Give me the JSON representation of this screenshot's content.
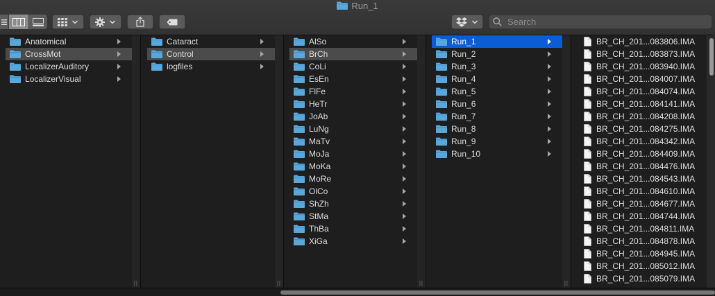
{
  "window": {
    "title": "Run_1"
  },
  "toolbar": {
    "search_placeholder": "Search"
  },
  "columns": [
    {
      "items": [
        {
          "label": "Anatomical",
          "kind": "folder",
          "has_children": true,
          "state": "normal"
        },
        {
          "label": "CrossMot",
          "kind": "folder",
          "has_children": true,
          "state": "selected-inactive"
        },
        {
          "label": "LocalizerAuditory",
          "kind": "folder",
          "has_children": true,
          "state": "normal"
        },
        {
          "label": "LocalizerVisual",
          "kind": "folder",
          "has_children": true,
          "state": "normal"
        }
      ]
    },
    {
      "items": [
        {
          "label": "Cataract",
          "kind": "folder",
          "has_children": true,
          "state": "normal"
        },
        {
          "label": "Control",
          "kind": "folder",
          "has_children": true,
          "state": "selected-inactive"
        },
        {
          "label": "logfiles",
          "kind": "folder",
          "has_children": true,
          "state": "normal"
        }
      ]
    },
    {
      "items": [
        {
          "label": "AlSo",
          "kind": "folder",
          "has_children": true,
          "state": "normal"
        },
        {
          "label": "BrCh",
          "kind": "folder",
          "has_children": true,
          "state": "selected-inactive"
        },
        {
          "label": "CoLi",
          "kind": "folder",
          "has_children": true,
          "state": "normal"
        },
        {
          "label": "EsEn",
          "kind": "folder",
          "has_children": true,
          "state": "normal"
        },
        {
          "label": "FlFe",
          "kind": "folder",
          "has_children": true,
          "state": "normal"
        },
        {
          "label": "HeTr",
          "kind": "folder",
          "has_children": true,
          "state": "normal"
        },
        {
          "label": "JoAb",
          "kind": "folder",
          "has_children": true,
          "state": "normal"
        },
        {
          "label": "LuNg",
          "kind": "folder",
          "has_children": true,
          "state": "normal"
        },
        {
          "label": "MaTv",
          "kind": "folder",
          "has_children": true,
          "state": "normal"
        },
        {
          "label": "MoJa",
          "kind": "folder",
          "has_children": true,
          "state": "normal"
        },
        {
          "label": "MoKa",
          "kind": "folder",
          "has_children": true,
          "state": "normal"
        },
        {
          "label": "MoRe",
          "kind": "folder",
          "has_children": true,
          "state": "normal"
        },
        {
          "label": "OlCo",
          "kind": "folder",
          "has_children": true,
          "state": "normal"
        },
        {
          "label": "ShZh",
          "kind": "folder",
          "has_children": true,
          "state": "normal"
        },
        {
          "label": "StMa",
          "kind": "folder",
          "has_children": true,
          "state": "normal"
        },
        {
          "label": "ThBa",
          "kind": "folder",
          "has_children": true,
          "state": "normal"
        },
        {
          "label": "XiGa",
          "kind": "folder",
          "has_children": true,
          "state": "normal"
        }
      ]
    },
    {
      "items": [
        {
          "label": "Run_1",
          "kind": "folder",
          "has_children": true,
          "state": "selected-active"
        },
        {
          "label": "Run_2",
          "kind": "folder",
          "has_children": true,
          "state": "normal"
        },
        {
          "label": "Run_3",
          "kind": "folder",
          "has_children": true,
          "state": "normal"
        },
        {
          "label": "Run_4",
          "kind": "folder",
          "has_children": true,
          "state": "normal"
        },
        {
          "label": "Run_5",
          "kind": "folder",
          "has_children": true,
          "state": "normal"
        },
        {
          "label": "Run_6",
          "kind": "folder",
          "has_children": true,
          "state": "normal"
        },
        {
          "label": "Run_7",
          "kind": "folder",
          "has_children": true,
          "state": "normal"
        },
        {
          "label": "Run_8",
          "kind": "folder",
          "has_children": true,
          "state": "normal"
        },
        {
          "label": "Run_9",
          "kind": "folder",
          "has_children": true,
          "state": "normal"
        },
        {
          "label": "Run_10",
          "kind": "folder",
          "has_children": true,
          "state": "normal"
        }
      ]
    },
    {
      "items": [
        {
          "label": "BR_CH_201...083806.IMA",
          "kind": "file",
          "has_children": false,
          "state": "normal"
        },
        {
          "label": "BR_CH_201...083873.IMA",
          "kind": "file",
          "has_children": false,
          "state": "normal"
        },
        {
          "label": "BR_CH_201...083940.IMA",
          "kind": "file",
          "has_children": false,
          "state": "normal"
        },
        {
          "label": "BR_CH_201...084007.IMA",
          "kind": "file",
          "has_children": false,
          "state": "normal"
        },
        {
          "label": "BR_CH_201...084074.IMA",
          "kind": "file",
          "has_children": false,
          "state": "normal"
        },
        {
          "label": "BR_CH_201...084141.IMA",
          "kind": "file",
          "has_children": false,
          "state": "normal"
        },
        {
          "label": "BR_CH_201...084208.IMA",
          "kind": "file",
          "has_children": false,
          "state": "normal"
        },
        {
          "label": "BR_CH_201...084275.IMA",
          "kind": "file",
          "has_children": false,
          "state": "normal"
        },
        {
          "label": "BR_CH_201...084342.IMA",
          "kind": "file",
          "has_children": false,
          "state": "normal"
        },
        {
          "label": "BR_CH_201...084409.IMA",
          "kind": "file",
          "has_children": false,
          "state": "normal"
        },
        {
          "label": "BR_CH_201...084476.IMA",
          "kind": "file",
          "has_children": false,
          "state": "normal"
        },
        {
          "label": "BR_CH_201...084543.IMA",
          "kind": "file",
          "has_children": false,
          "state": "normal"
        },
        {
          "label": "BR_CH_201...084610.IMA",
          "kind": "file",
          "has_children": false,
          "state": "normal"
        },
        {
          "label": "BR_CH_201...084677.IMA",
          "kind": "file",
          "has_children": false,
          "state": "normal"
        },
        {
          "label": "BR_CH_201...084744.IMA",
          "kind": "file",
          "has_children": false,
          "state": "normal"
        },
        {
          "label": "BR_CH_201...084811.IMA",
          "kind": "file",
          "has_children": false,
          "state": "normal"
        },
        {
          "label": "BR_CH_201...084878.IMA",
          "kind": "file",
          "has_children": false,
          "state": "normal"
        },
        {
          "label": "BR_CH_201...084945.IMA",
          "kind": "file",
          "has_children": false,
          "state": "normal"
        },
        {
          "label": "BR_CH_201...085012.IMA",
          "kind": "file",
          "has_children": false,
          "state": "normal"
        },
        {
          "label": "BR_CH_201...085079.IMA",
          "kind": "file",
          "has_children": false,
          "state": "normal"
        }
      ]
    }
  ],
  "colors": {
    "folder": "#5aa7dc",
    "selection_active": "#0b5dd6",
    "selection_inactive": "#4b4b4b",
    "background": "#1e1e1e"
  },
  "icons": {
    "view_list": "list-view-icon",
    "view_columns": "column-view-icon",
    "view_gallery": "gallery-view-icon",
    "group": "group-by-icon",
    "action": "gear-icon",
    "share": "share-icon",
    "tags": "tag-icon",
    "dropbox": "dropbox-icon",
    "search": "search-icon"
  }
}
